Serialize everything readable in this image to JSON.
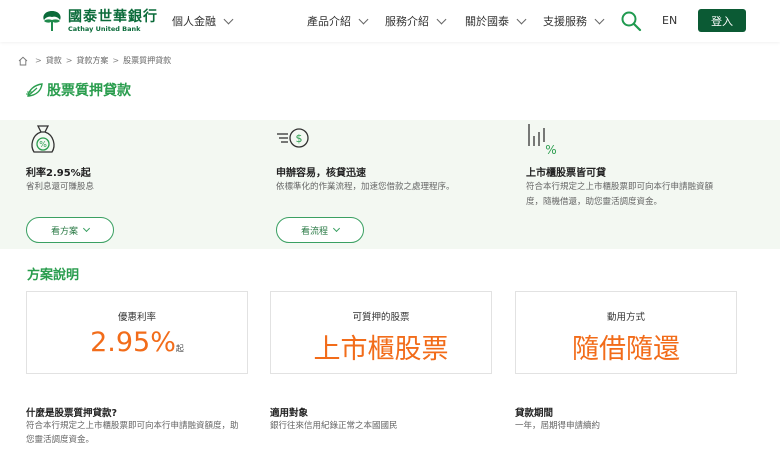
{
  "header": {
    "logo_zh": "國泰世華銀行",
    "logo_en": "Cathay United Bank",
    "personal_finance": "個人金融",
    "nav": [
      "產品介紹",
      "服務介紹",
      "關於國泰",
      "支援服務"
    ],
    "lang": "EN",
    "login": "登入"
  },
  "breadcrumb": [
    "貸款",
    "貸款方案",
    "股票質押貸款"
  ],
  "page_title": "股票質押貸款",
  "features": [
    {
      "icon": "money-bag-percent-icon",
      "title": "利率2.95%起",
      "desc": "省利息還可賺股息",
      "button": "看方案"
    },
    {
      "icon": "fast-money-icon",
      "title": "申辦容易，核貸迅速",
      "desc": "依標準化的作業流程，加速您借款之處理程序。",
      "button": "看流程"
    },
    {
      "icon": "stock-chart-percent-icon",
      "title": "上市櫃股票皆可貸",
      "desc": "符合本行規定之上市櫃股票即可向本行申請融資額度，隨機借還，助您靈活調度資金。"
    }
  ],
  "plan": {
    "title": "方案說明",
    "cards": [
      {
        "label": "優惠利率",
        "value": "2.95%",
        "suffix": "起"
      },
      {
        "label": "可質押的股票",
        "value": "上市櫃股票"
      },
      {
        "label": "動用方式",
        "value": "隨借隨還"
      }
    ],
    "info": [
      {
        "title": "什麼是股票質押貸款?",
        "desc": "符合本行規定之上市櫃股票即可向本行申請融資額度，助您靈活調度資金。"
      },
      {
        "title": "適用對象",
        "desc": "銀行往來信用紀錄正常之本國國民"
      },
      {
        "title": "貸款期間",
        "desc": "一年，屆期得申請續約"
      }
    ]
  },
  "colors": {
    "brand": "#0b6b3a",
    "accent_green": "#2a9d4e",
    "highlight_orange": "#f26c1a",
    "band_bg": "#f3f8f2"
  }
}
